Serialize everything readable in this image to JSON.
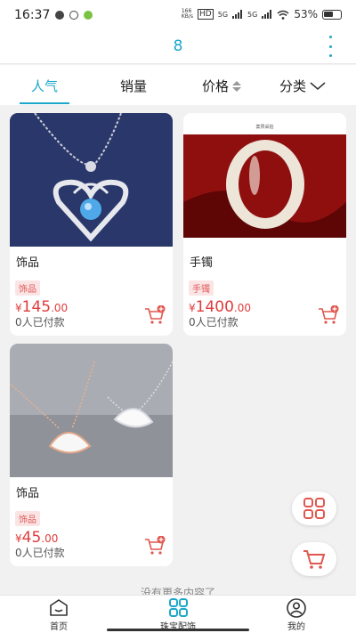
{
  "status_bar": {
    "time": "16:37",
    "net_speed_top": "166",
    "net_speed_bottom": "KB/s",
    "hd_label": "HD",
    "signal_1": "5G",
    "signal_2": "5G",
    "battery": "53%"
  },
  "header": {
    "title": "8"
  },
  "tabs": [
    {
      "label": "人气"
    },
    {
      "label": "销量"
    },
    {
      "label": "价格"
    },
    {
      "label": "分类"
    }
  ],
  "products": [
    {
      "title": "饰品",
      "badge": "饰品",
      "currency": "¥",
      "price_int": "145",
      "price_dec": ".00",
      "paid": "0人已付款"
    },
    {
      "title": "手镯",
      "badge": "手镯",
      "currency": "¥",
      "price_int": "1400",
      "price_dec": ".00",
      "paid": "0人已付款",
      "image_caption": "案貝采拍"
    },
    {
      "title": "饰品",
      "badge": "饰品",
      "currency": "¥",
      "price_int": "45",
      "price_dec": ".00",
      "paid": "0人已付款"
    }
  ],
  "end_text": "没有更多内容了",
  "bottom_nav": [
    {
      "label": "首页"
    },
    {
      "label": "珠宝配饰"
    },
    {
      "label": "我的"
    }
  ],
  "colors": {
    "accent": "#1aa7c9",
    "price": "#e23c3c",
    "icon_red": "#e0574f"
  }
}
